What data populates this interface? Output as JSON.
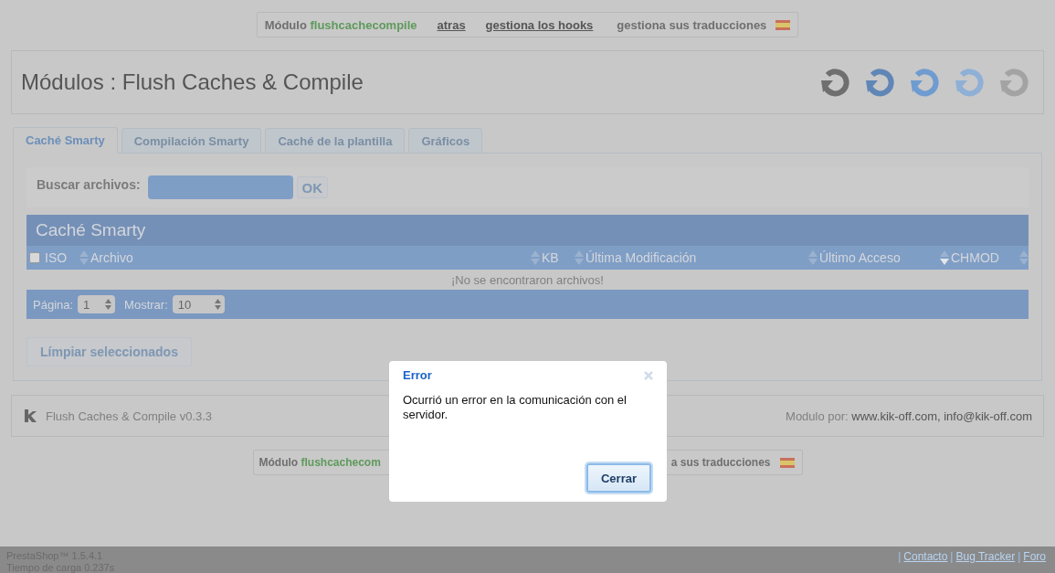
{
  "top_links": {
    "module_label": "Módulo",
    "module_name": "flushcachecompile",
    "links": [
      "atras",
      "gestiona los hooks"
    ],
    "translations": "gestiona sus traducciones"
  },
  "header": {
    "title": "Módulos : Flush Caches & Compile",
    "icons": [
      {
        "color": "#6f6f6f"
      },
      {
        "color": "#5f86b6"
      },
      {
        "color": "#6f9cd0"
      },
      {
        "color": "#8fb0d6"
      },
      {
        "color": "#a3a3a3"
      }
    ]
  },
  "tabs": [
    {
      "label": "Caché Smarty",
      "selected": true
    },
    {
      "label": "Compilación Smarty",
      "selected": false
    },
    {
      "label": "Caché de la plantilla",
      "selected": false
    },
    {
      "label": "Gráficos",
      "selected": false
    }
  ],
  "search": {
    "label": "Buscar archivos:",
    "button": "OK"
  },
  "table": {
    "title": "Caché Smarty",
    "select_all_checked": false,
    "columns": [
      {
        "label": "ISO",
        "sorted": false
      },
      {
        "label": "Archivo",
        "sorted": false
      },
      {
        "label": "KB",
        "sorted": false
      },
      {
        "label": "Última Modificación",
        "sorted": false
      },
      {
        "label": "Último Acceso",
        "sorted": true
      },
      {
        "label": "CHMOD",
        "sorted": false
      }
    ],
    "empty_message": "¡No se encontraron archivos!",
    "pagination": {
      "page_label": "Página:",
      "page_value": "1",
      "show_label": "Mostrar:",
      "show_value": "10"
    }
  },
  "clear_button": "Límpiar seleccionados",
  "footer": {
    "version": "Flush Caches & Compile v0.3.3",
    "author_label": "Modulo por:",
    "author_value": "www.kik-off.com, info@kik-off.com"
  },
  "bottom_links": {
    "module_label": "Módulo",
    "module_name": "flushcachecom",
    "translations": "a sus traducciones"
  },
  "dialog": {
    "title": "Error",
    "message": "Ocurrió un error en la comunicación con el servidor.",
    "button": "Cerrar"
  },
  "status_bar": {
    "version": "PrestaShop™ 1.5.4.1",
    "load_time": "Tiempo de carga 0.237s",
    "separator": "|",
    "links": [
      "Contacto",
      "Bug Tracker",
      "Foro"
    ]
  }
}
